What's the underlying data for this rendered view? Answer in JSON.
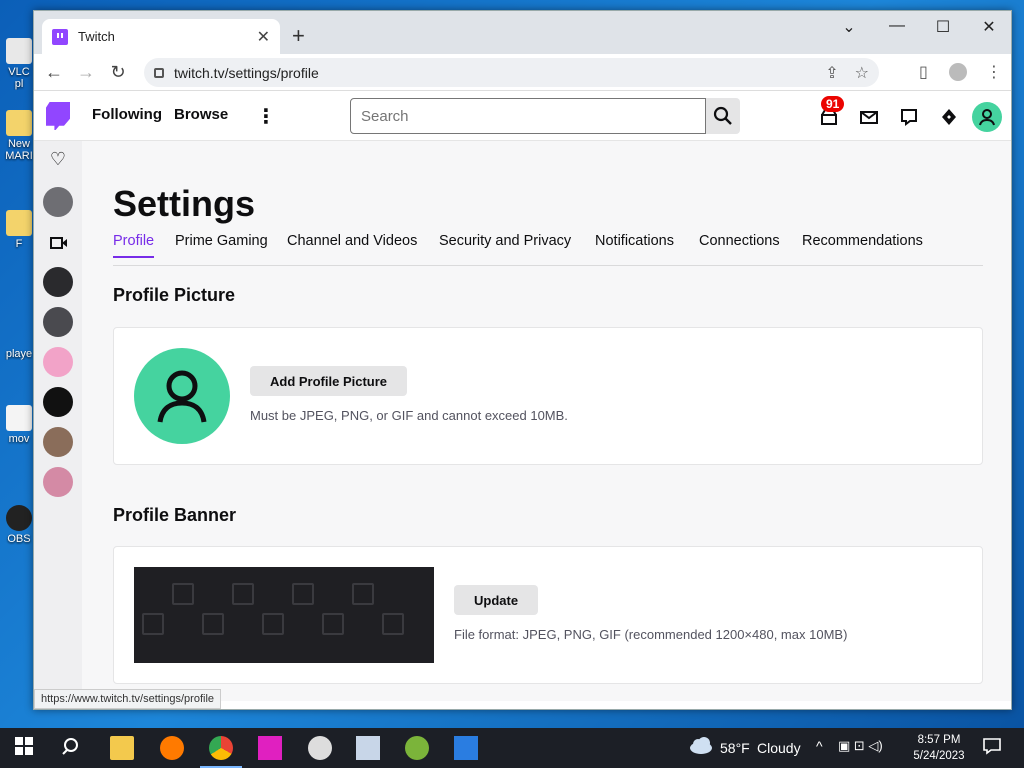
{
  "desktop": {
    "icons": [
      {
        "label": "VLC",
        "sub": "pl"
      },
      {
        "label": "New",
        "sub": "MARI"
      },
      {
        "label": "F"
      },
      {
        "label": "playe"
      },
      {
        "label": "mov"
      },
      {
        "label": "OBS"
      }
    ]
  },
  "browser": {
    "tab_title": "Twitch",
    "new_tab": "+",
    "url": "twitch.tv/settings/profile",
    "status_url": "https://www.twitch.tv/settings/profile"
  },
  "twitch_nav": {
    "following": "Following",
    "browse": "Browse",
    "more": "⋮",
    "search_placeholder": "Search",
    "notification_count": "91"
  },
  "settings": {
    "title": "Settings",
    "tabs": [
      "Profile",
      "Prime Gaming",
      "Channel and Videos",
      "Security and Privacy",
      "Notifications",
      "Connections",
      "Recommendations"
    ],
    "active_tab": "Profile",
    "profile_picture": {
      "heading": "Profile Picture",
      "button": "Add Profile Picture",
      "hint": "Must be JPEG, PNG, or GIF and cannot exceed 10MB."
    },
    "profile_banner": {
      "heading": "Profile Banner",
      "button": "Update",
      "hint": "File format: JPEG, PNG, GIF (recommended 1200×480, max 10MB)"
    }
  },
  "taskbar": {
    "weather_temp": "58°F",
    "weather_desc": "Cloudy",
    "time": "8:57 PM",
    "date": "5/24/2023"
  },
  "colors": {
    "twitch_purple": "#9146ff",
    "active_tab": "#772ce8",
    "avatar_green": "#45d39f",
    "badge_red": "#eb0400"
  }
}
